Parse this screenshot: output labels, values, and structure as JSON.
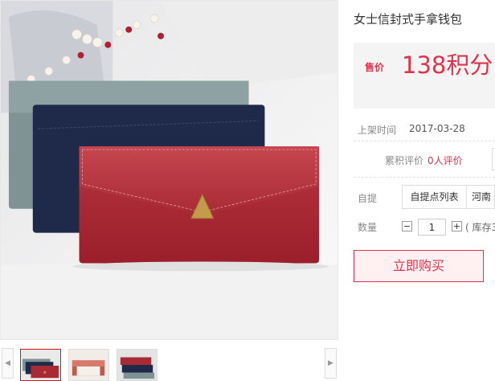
{
  "product": {
    "title": "女士信封式手拿钱包",
    "price_label": "售价",
    "price_value": "138积分"
  },
  "details": {
    "list_date_label": "上架时间",
    "list_date": "2017-03-28",
    "reviews_label": "累积评价",
    "reviews_count": "0人评价",
    "pickup_label": "自提",
    "pickup_list_button": "自提点列表",
    "pickup_region": "河南",
    "quantity_label": "数量",
    "quantity_decrement": "−",
    "quantity_value": "1",
    "quantity_increment": "+",
    "stock_text": "( 库存3"
  },
  "actions": {
    "buy_now": "立即购买"
  },
  "gallery": {
    "prev_arrow": "◀",
    "next_arrow": "▶",
    "thumbnails": [
      "thumb-1",
      "thumb-2",
      "thumb-3"
    ]
  },
  "colors": {
    "accent": "#e3314b",
    "price_bg": "#f4f4f4",
    "buy_bg": "#fff1f1"
  }
}
